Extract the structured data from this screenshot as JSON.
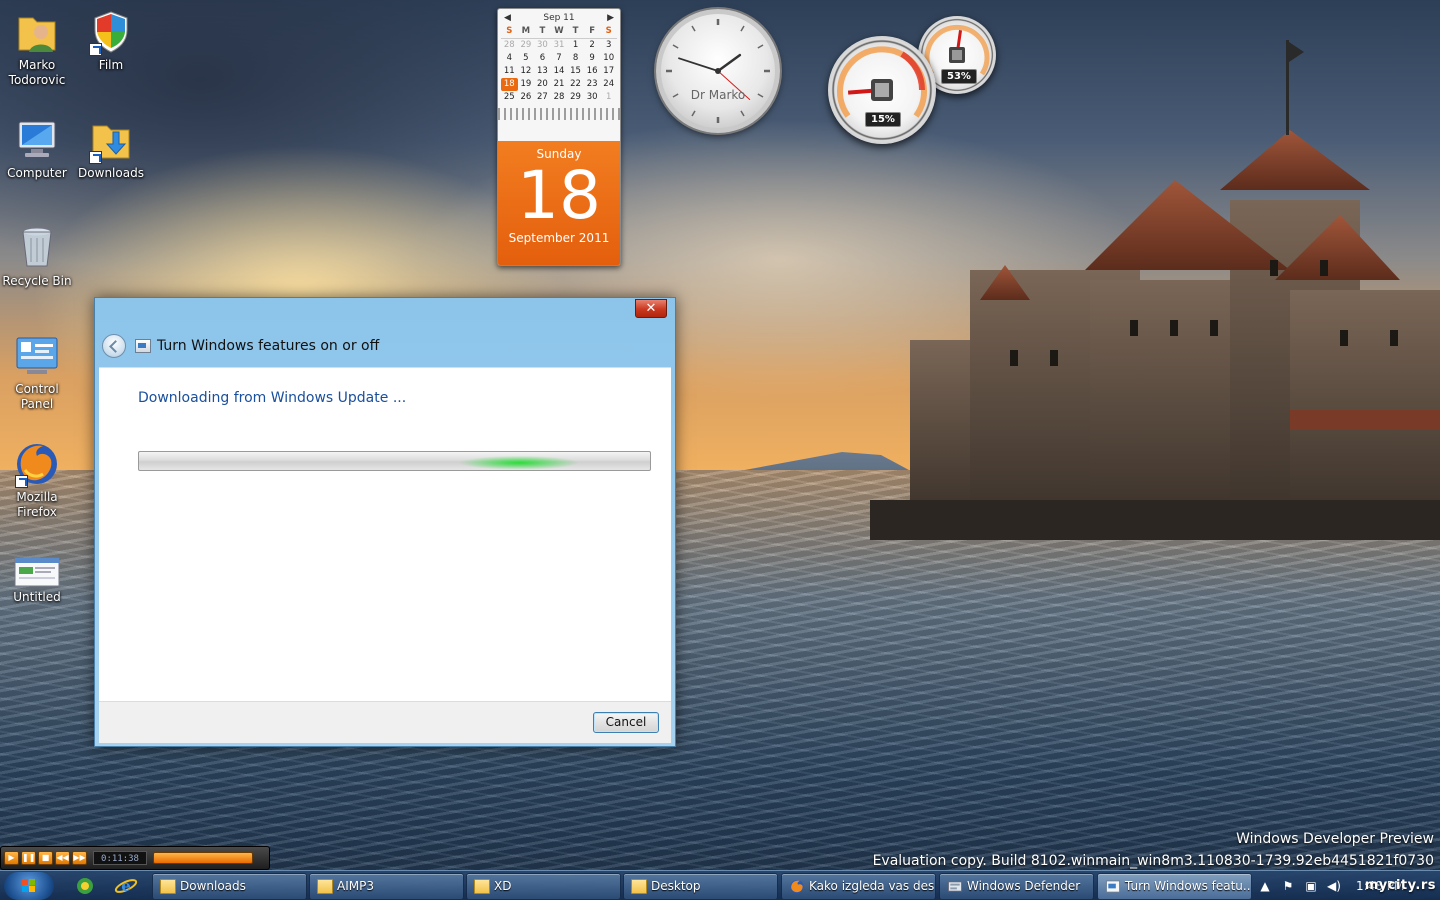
{
  "desktop": {
    "icons": [
      {
        "label": "Marko Todorovic",
        "icon": "user-folder-icon"
      },
      {
        "label": "Film",
        "icon": "shield-icon"
      },
      {
        "label": "Computer",
        "icon": "computer-icon"
      },
      {
        "label": "Downloads",
        "icon": "downloads-folder-icon"
      },
      {
        "label": "Recycle Bin",
        "icon": "recycle-bin-icon"
      },
      {
        "label": "Control Panel",
        "icon": "control-panel-icon"
      },
      {
        "label": "Mozilla Firefox",
        "icon": "firefox-icon"
      },
      {
        "label": "Untitled",
        "icon": "document-icon"
      }
    ]
  },
  "calendar": {
    "month_label": "Sep 11",
    "weekdays": [
      "S",
      "M",
      "T",
      "W",
      "T",
      "F",
      "S"
    ],
    "days": [
      "28",
      "29",
      "30",
      "31",
      "1",
      "2",
      "3",
      "4",
      "5",
      "6",
      "7",
      "8",
      "9",
      "10",
      "11",
      "12",
      "13",
      "14",
      "15",
      "16",
      "17",
      "18",
      "19",
      "20",
      "21",
      "22",
      "23",
      "24",
      "25",
      "26",
      "27",
      "28",
      "29",
      "30",
      "1"
    ],
    "today": "18",
    "day_name": "Sunday",
    "day_number": "18",
    "month_year": "September 2011"
  },
  "clock": {
    "label": "Dr Marko",
    "time": {
      "hour": 1,
      "minute": 48,
      "second": 22
    }
  },
  "cpu_meter": {
    "cpu_percent": "15%",
    "cpu_value": 15,
    "memory_percent": "53%",
    "memory_value": 53
  },
  "dialog": {
    "title": "Turn Windows features on or off",
    "close_label": "✕",
    "status": "Downloading from Windows Update ...",
    "cancel_label": "Cancel",
    "progress_state": "marquee"
  },
  "watermark": {
    "line1": "Windows Developer Preview",
    "line2": "Evaluation copy. Build 8102.winmain_win8m3.110830-1739.92eb4451821f0730"
  },
  "media_player": {
    "time": "0:11:38"
  },
  "taskbar": {
    "tasks": [
      {
        "label": "Downloads",
        "icon": "folder-icon"
      },
      {
        "label": "AIMP3",
        "icon": "folder-icon"
      },
      {
        "label": "XD",
        "icon": "folder-icon"
      },
      {
        "label": "Desktop",
        "icon": "folder-icon"
      },
      {
        "label": "Kako izgleda vas des...",
        "icon": "firefox-icon"
      },
      {
        "label": "Windows Defender",
        "icon": "defender-icon"
      },
      {
        "label": "Turn Windows featu...",
        "icon": "features-icon"
      }
    ],
    "clock": "1:48 PM",
    "site": "mycity.rs"
  },
  "colors": {
    "accent_orange": "#ea6a12",
    "dialog_frame": "#8cc4ea",
    "link_blue": "#1a4f9c",
    "progress_green": "#2cdc3a"
  }
}
